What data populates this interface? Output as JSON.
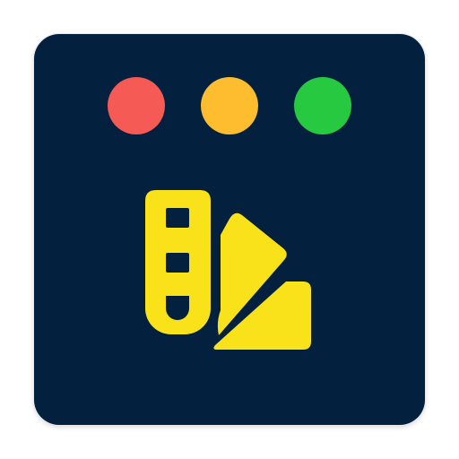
{
  "icon": {
    "name": "color-swatch-icon",
    "background": "#03213f",
    "accent": "#f9e21a"
  },
  "window_controls": {
    "close_color": "#f55a55",
    "minimize_color": "#fdbd2f",
    "zoom_color": "#27c941"
  }
}
